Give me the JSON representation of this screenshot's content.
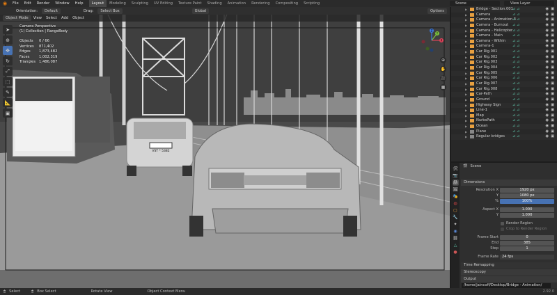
{
  "menubar": {
    "items": [
      "File",
      "Edit",
      "Render",
      "Window",
      "Help"
    ],
    "workspaces": [
      "Layout",
      "Modeling",
      "Sculpting",
      "UV Editing",
      "Texture Paint",
      "Shading",
      "Animation",
      "Rendering",
      "Compositing",
      "Scripting"
    ],
    "active_workspace": "Layout",
    "scene": "Scene",
    "view_layer": "View Layer"
  },
  "viewport_header": {
    "orientation_label": "Orientation:",
    "orientation_value": "Default",
    "drag_label": "Drag:",
    "drag_value": "Select Box",
    "transform_space": "Global",
    "options": "Options"
  },
  "viewport_header2": {
    "mode": "Object Mode",
    "view": "View",
    "select": "Select",
    "add": "Add",
    "object": "Object"
  },
  "viewport_overlay": {
    "line1": "Camera Perspective",
    "line2": "(1) Collection | RangeBody",
    "stats": [
      {
        "k": "Objects",
        "v": "0 / 66"
      },
      {
        "k": "Vertices",
        "v": "871,402"
      },
      {
        "k": "Edges",
        "v": "1,873,482"
      },
      {
        "k": "Faces",
        "v": "1,002,319"
      },
      {
        "k": "Triangles",
        "v": "1,486,087"
      }
    ],
    "plate_text": "VST * 5382",
    "gizmo": {
      "x": "X",
      "y": "Y",
      "z": "Z"
    }
  },
  "outliner": {
    "items": [
      {
        "name": "Bridge - Section.001",
        "icon": "object-icon",
        "color": "#e8a040"
      },
      {
        "name": "Camera",
        "icon": "camera-icon",
        "color": "#e8a040"
      },
      {
        "name": "Camera - Animation 3",
        "icon": "camera-icon",
        "color": "#e8a040"
      },
      {
        "name": "Camera - Burnout",
        "icon": "camera-icon",
        "color": "#e8a040"
      },
      {
        "name": "Camera - Helicopter",
        "icon": "camera-icon",
        "color": "#e8a040"
      },
      {
        "name": "Camera - Main",
        "icon": "camera-icon",
        "color": "#e8a040"
      },
      {
        "name": "Camera - Within",
        "icon": "camera-icon",
        "color": "#e8a040"
      },
      {
        "name": "Camera-1",
        "icon": "camera-icon",
        "color": "#e8a040"
      },
      {
        "name": "Car Rig.001",
        "icon": "armature-icon",
        "color": "#e8a040"
      },
      {
        "name": "Car Rig.002",
        "icon": "armature-icon",
        "color": "#e8a040"
      },
      {
        "name": "Car Rig.003",
        "icon": "armature-icon",
        "color": "#e8a040"
      },
      {
        "name": "Car Rig.004",
        "icon": "armature-icon",
        "color": "#e8a040"
      },
      {
        "name": "Car Rig.005",
        "icon": "armature-icon",
        "color": "#e8a040"
      },
      {
        "name": "Car Rig.006",
        "icon": "armature-icon",
        "color": "#e8a040"
      },
      {
        "name": "Car Rig.007",
        "icon": "armature-icon",
        "color": "#e8a040"
      },
      {
        "name": "Car Rig.008",
        "icon": "armature-icon",
        "color": "#e8a040"
      },
      {
        "name": "Car-Path",
        "icon": "curve-icon",
        "color": "#e8a040"
      },
      {
        "name": "Ground",
        "icon": "mesh-icon",
        "color": "#e8a040"
      },
      {
        "name": "Highway Sign",
        "icon": "mesh-icon",
        "color": "#e8a040"
      },
      {
        "name": "Line-1",
        "icon": "curve-icon",
        "color": "#e8a040"
      },
      {
        "name": "Map",
        "icon": "mesh-icon",
        "color": "#e8a040"
      },
      {
        "name": "NurbsPath",
        "icon": "curve-icon",
        "color": "#e8a040"
      },
      {
        "name": "Ocean",
        "icon": "mesh-icon",
        "color": "#e8a040"
      },
      {
        "name": "Plane",
        "icon": "mesh-icon",
        "color": "#888888"
      },
      {
        "name": "Regular bridges",
        "icon": "collection-icon",
        "color": "#888888"
      }
    ]
  },
  "properties": {
    "scene_label": "Scene",
    "dimensions_header": "Dimensions",
    "resolution_x_label": "Resolution X",
    "resolution_x": "1920 px",
    "y_label": "Y",
    "resolution_y": "1080 px",
    "percent_label": "%",
    "percent": "100%",
    "aspect_x_label": "Aspect X",
    "aspect_x": "1.000",
    "aspect_y_label": "Y",
    "aspect_y": "1.000",
    "render_region": "Render Region",
    "crop_region": "Crop to Render Region",
    "frame_start_label": "Frame Start",
    "frame_start": "0",
    "end_label": "End",
    "frame_end": "385",
    "step_label": "Step",
    "step": "1",
    "frame_rate_label": "Frame Rate",
    "frame_rate": "24 fps",
    "time_remapping": "Time Remapping",
    "stereoscopy": "Stereoscopy",
    "output": "Output",
    "output_path": "/home/jaincoff/Desktop/Bridge - Animation/"
  },
  "statusbar": {
    "select": "Select",
    "box_select": "Box Select",
    "rotate_view": "Rotate View",
    "context_menu": "Object Context Menu",
    "version": "2.92.0"
  }
}
